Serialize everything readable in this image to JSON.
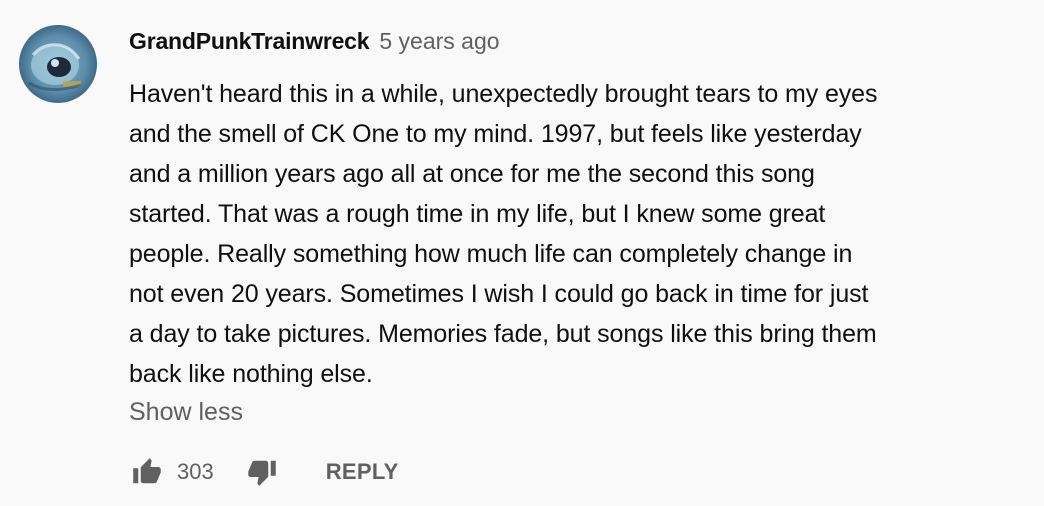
{
  "comment": {
    "author": "GrandPunkTrainwreck",
    "timestamp": "5 years ago",
    "text": "Haven't heard this in a while, unexpectedly brought tears to my eyes\nand the smell of CK One to my mind.  1997, but feels like yesterday\nand a million years ago all at once for me the second this song\nstarted.  That was a rough time in my life, but I knew some great\npeople.  Really something how much life can completely change in\nnot even 20 years.  Sometimes I wish I could go back in time for just\na day to take pictures.  Memories fade, but songs like this bring them\nback like nothing else.",
    "show_less_label": "Show less",
    "like_count": "303",
    "reply_label": "REPLY",
    "avatar_icon": "avatar-image",
    "like_icon": "thumbs-up-icon",
    "dislike_icon": "thumbs-down-icon"
  },
  "colors": {
    "background": "#f9f9f9",
    "primary_text": "#0f0f0f",
    "secondary_text": "#606060"
  }
}
